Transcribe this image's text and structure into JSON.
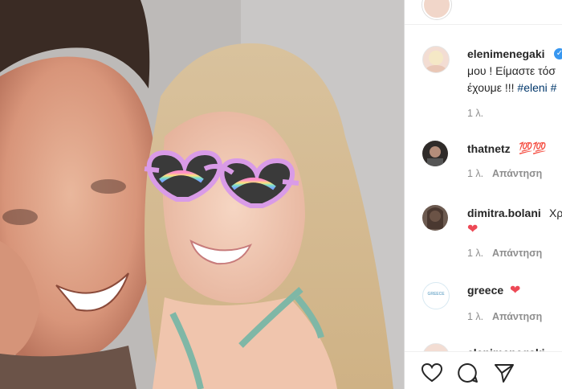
{
  "post": {
    "author": "elenimenegaki",
    "caption_line1": "μου ! Είμαστε τόσ",
    "caption_line2_prefix": "έχουμε !!! ",
    "caption_line2_tag": "#eleni",
    "caption_line2_tail": " #",
    "time": "1 λ."
  },
  "comments": [
    {
      "user": "thatnetz",
      "emoji": "💯💯",
      "time": "1 λ.",
      "reply": "Απάντηση"
    },
    {
      "user": "dimitra.bolani",
      "text": "Χρ",
      "emoji": "❤",
      "time": "1 λ.",
      "reply": "Απάντηση"
    },
    {
      "user": "greece",
      "emoji": "❤",
      "time": "1 λ.",
      "reply": "Απάντηση",
      "avatar_text": "GREECE"
    },
    {
      "user": "elenimenegaki"
    }
  ],
  "actions": [
    "heart-icon",
    "comment-icon",
    "share-icon"
  ],
  "colors": {
    "hashtag": "#00376b",
    "heart": "#ed4956",
    "verified": "#3897f0"
  }
}
